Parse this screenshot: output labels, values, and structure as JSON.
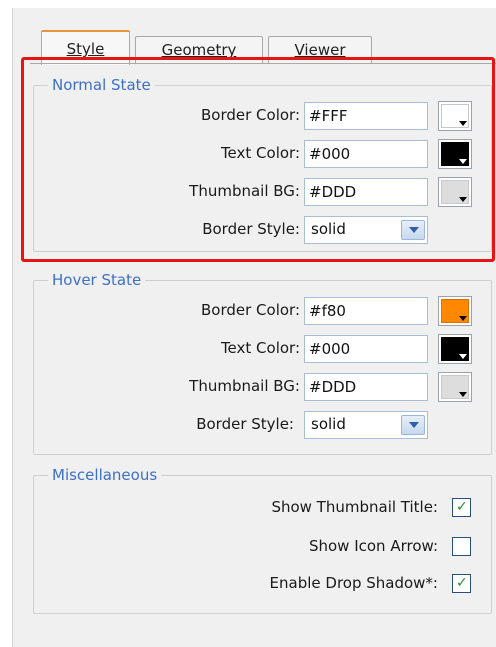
{
  "tabs": [
    {
      "label": "Style",
      "active": true
    },
    {
      "label": "Geometry",
      "active": false
    },
    {
      "label": "Viewer",
      "active": false
    }
  ],
  "normal_state": {
    "legend": "Normal State",
    "border_color": {
      "label": "Border Color:",
      "value": "#FFF",
      "swatch": "#ffffff"
    },
    "text_color": {
      "label": "Text Color:",
      "value": "#000",
      "swatch": "#000000"
    },
    "thumbnail_bg": {
      "label": "Thumbnail BG:",
      "value": "#DDD",
      "swatch": "#dddddd"
    },
    "border_style": {
      "label": "Border Style:",
      "value": "solid"
    }
  },
  "hover_state": {
    "legend": "Hover State",
    "border_color": {
      "label": "Border Color:",
      "value": "#f80",
      "swatch": "#ff8800"
    },
    "text_color": {
      "label": "Text Color:",
      "value": "#000",
      "swatch": "#000000"
    },
    "thumbnail_bg": {
      "label": "Thumbnail BG:",
      "value": "#DDD",
      "swatch": "#dddddd"
    },
    "border_style": {
      "label": "Border Style:",
      "value": "solid"
    }
  },
  "misc": {
    "legend": "Miscellaneous",
    "show_thumbnail_title": {
      "label": "Show Thumbnail Title:",
      "checked": true
    },
    "show_icon_arrow": {
      "label": "Show Icon Arrow:",
      "checked": false
    },
    "enable_drop_shadow": {
      "label": "Enable Drop Shadow*:",
      "checked": true
    }
  },
  "colors": {
    "accent": "#3d6fc7",
    "highlight": "#e61414",
    "tab_active": "#e8943a"
  }
}
